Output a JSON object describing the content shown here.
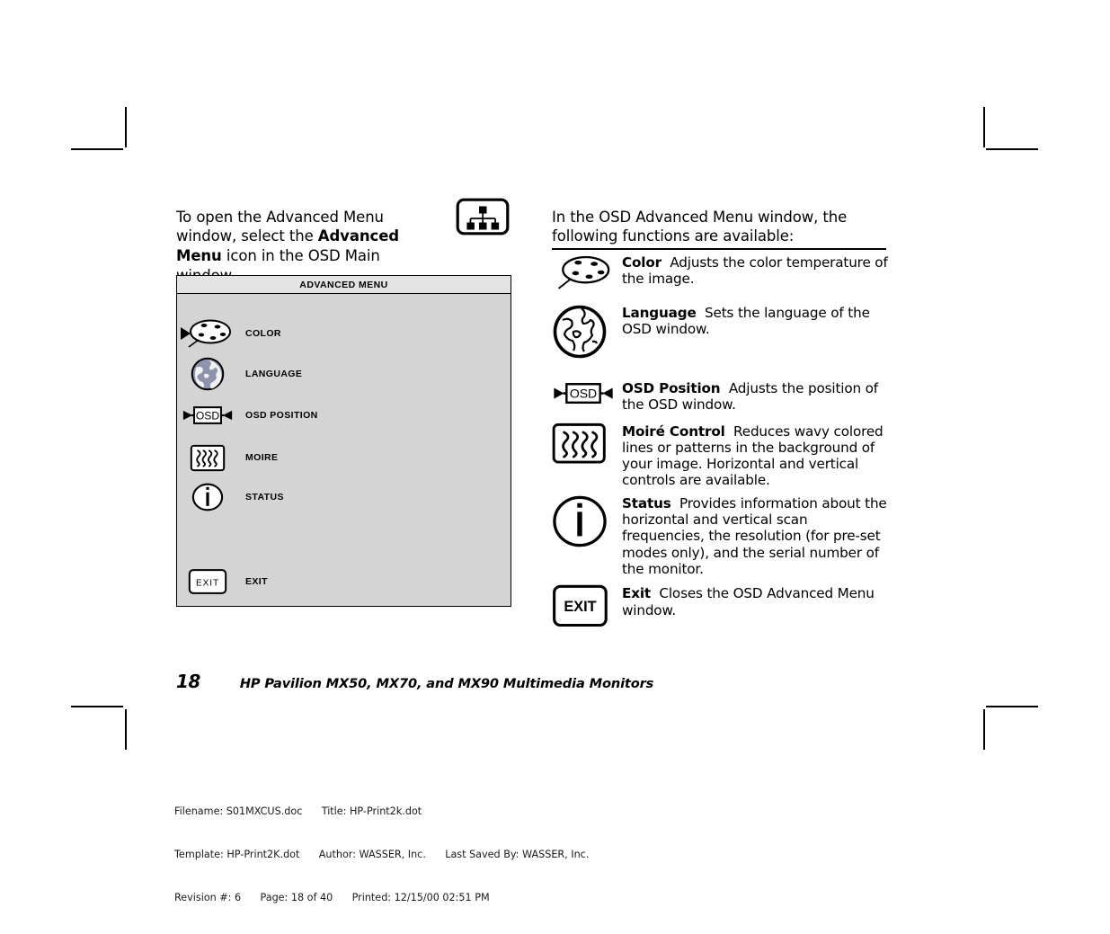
{
  "document": {
    "page_number": "18",
    "book_title": "HP Pavilion MX50, MX70, and MX90 Multimedia Monitors"
  },
  "left": {
    "intro_before": "To open the Advanced Menu window, select the ",
    "intro_bold": "Advanced Menu",
    "intro_after": " icon in the OSD Main window.",
    "advanced_menu_icon": "advanced-menu-icon"
  },
  "osd_window": {
    "title": "ADVANCED MENU",
    "selected_index": 0,
    "background_color": "#d4d4d4",
    "titlebar_color": "#e3e3e3",
    "border_color": "#000000",
    "items": [
      {
        "label": "COLOR",
        "icon": "palette-icon"
      },
      {
        "label": "LANGUAGE",
        "icon": "globe-icon"
      },
      {
        "label": "OSD POSITION",
        "icon": "osd-position-icon",
        "icon_text": "OSD"
      },
      {
        "label": "MOIRE",
        "icon": "moire-icon"
      },
      {
        "label": "STATUS",
        "icon": "info-icon"
      },
      {
        "label": "EXIT",
        "icon": "exit-icon",
        "icon_text": "EXIT"
      }
    ]
  },
  "right": {
    "intro": "In the OSD Advanced Menu window, the following functions are available:",
    "functions": [
      {
        "icon": "palette-icon",
        "term": "Color",
        "description": "Adjusts the color temperature of the image."
      },
      {
        "icon": "globe-icon",
        "term": "Language",
        "description": "Sets the language of the OSD window."
      },
      {
        "icon": "osd-position-icon",
        "icon_text": "OSD",
        "term": "OSD Position",
        "description": "Adjusts the position of the OSD window."
      },
      {
        "icon": "moire-icon",
        "term": "Moiré Control",
        "description": "Reduces wavy colored lines or patterns in the background of your image. Horizontal and vertical controls are available."
      },
      {
        "icon": "info-icon",
        "term": "Status",
        "description": "Provides information about the horizontal and vertical scan frequencies, the resolution (for pre-set modes only), and the serial number of the monitor."
      },
      {
        "icon": "exit-icon",
        "icon_text": "EXIT",
        "term": "Exit",
        "description": "Closes the OSD Advanced Menu window."
      }
    ]
  },
  "doc_meta": {
    "line1": "Filename: S01MXCUS.doc      Title: HP-Print2k.dot",
    "line2": "Template: HP-Print2K.dot      Author: WASSER, Inc.      Last Saved By: WASSER, Inc.",
    "line3": "Revision #: 6      Page: 18 of 40      Printed: 12/15/00 02:51 PM"
  }
}
